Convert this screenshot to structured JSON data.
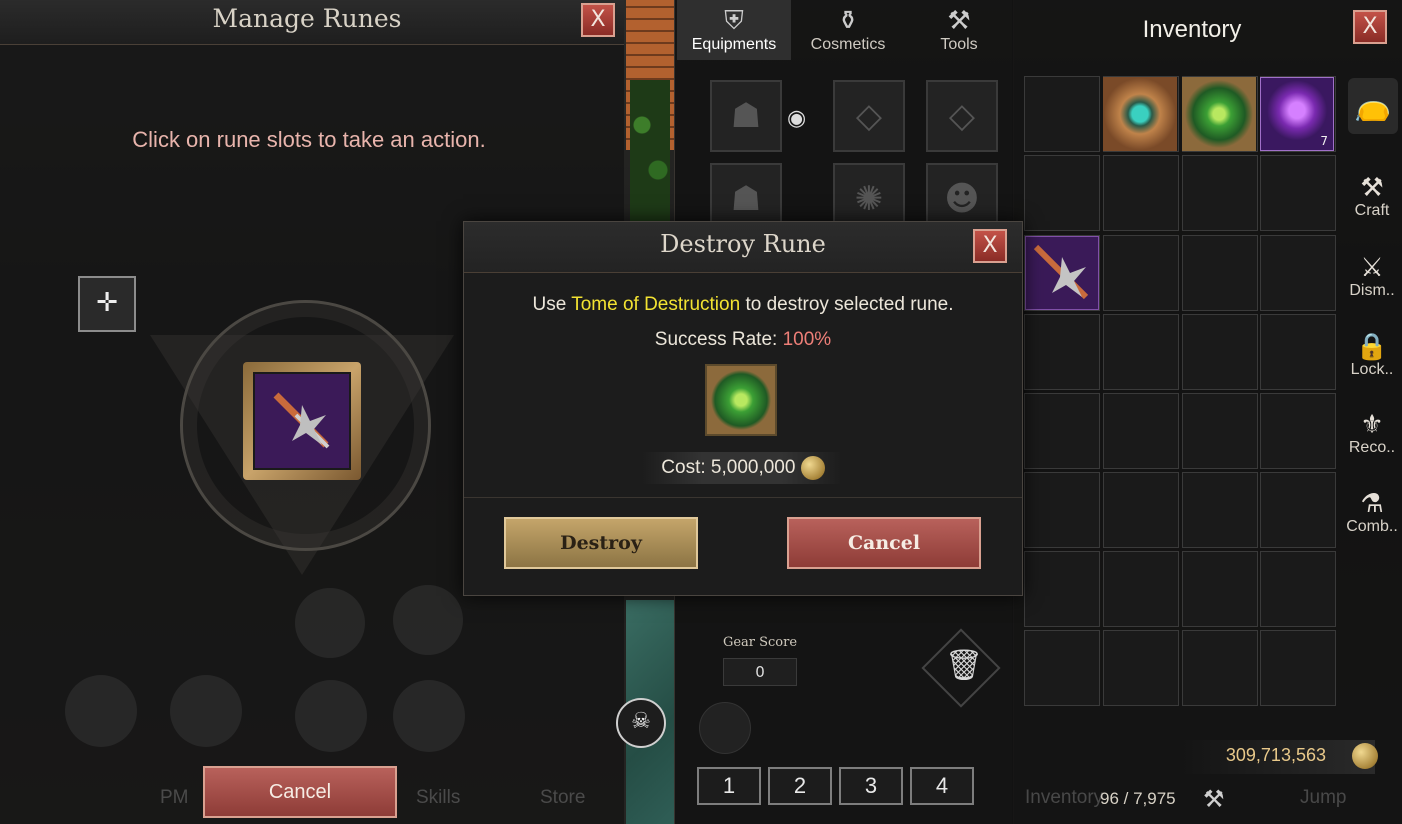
{
  "manage_runes": {
    "title": "Manage Runes",
    "close_label": "X",
    "hint": "Click on rune slots to take an action.",
    "move_icon": "move-icon",
    "cancel_label": "Cancel"
  },
  "equipment": {
    "tabs": [
      {
        "label": "Equipments",
        "icon": "armor-icon",
        "active": true
      },
      {
        "label": "Cosmetics",
        "icon": "hanger-icon",
        "active": false
      },
      {
        "label": "Tools",
        "icon": "hammer-icon",
        "active": false
      }
    ],
    "gear_score_label": "Gear Score",
    "gear_score_value": "0",
    "presets": [
      "1",
      "2",
      "3",
      "4"
    ]
  },
  "inventory": {
    "title": "Inventory",
    "close_label": "X",
    "items": [
      {
        "slot": 1,
        "name": "Eye Scroll",
        "icon": "eye-scroll-icon"
      },
      {
        "slot": 2,
        "name": "Tome of Destruction",
        "icon": "tome-icon"
      },
      {
        "slot": 3,
        "name": "Purple Gem",
        "icon": "purple-gem-icon",
        "count": "7"
      },
      {
        "slot": 8,
        "name": "Spear Rune",
        "icon": "spear-rune-icon"
      }
    ],
    "side_actions": [
      {
        "label": "Craft",
        "icon": "anvil-icon"
      },
      {
        "label": "Dism..",
        "icon": "dismantle-icon"
      },
      {
        "label": "Lock..",
        "icon": "lock-icon"
      },
      {
        "label": "Reco..",
        "icon": "recover-icon"
      },
      {
        "label": "Comb..",
        "icon": "combine-icon"
      }
    ],
    "bag_icon": "bag-icon",
    "gold": "309,713,563",
    "capacity": "96 / 7,975",
    "bottom_menu": [
      "PM",
      "Skills",
      "Store",
      "Inventory",
      "Jump"
    ]
  },
  "dialog": {
    "title": "Destroy Rune",
    "close_label": "X",
    "text_prefix": "Use ",
    "item_name": "Tome of Destruction",
    "text_suffix": " to destroy selected rune.",
    "success_label": "Success Rate: ",
    "success_value": "100%",
    "cost_label": "Cost: 5,000,000",
    "destroy_label": "Destroy",
    "cancel_label": "Cancel"
  },
  "colors": {
    "highlight_yellow": "#f2e232",
    "success_red": "#ee7f78",
    "hint_pink": "#e8b4ac",
    "gold_text": "#e9c98a"
  }
}
